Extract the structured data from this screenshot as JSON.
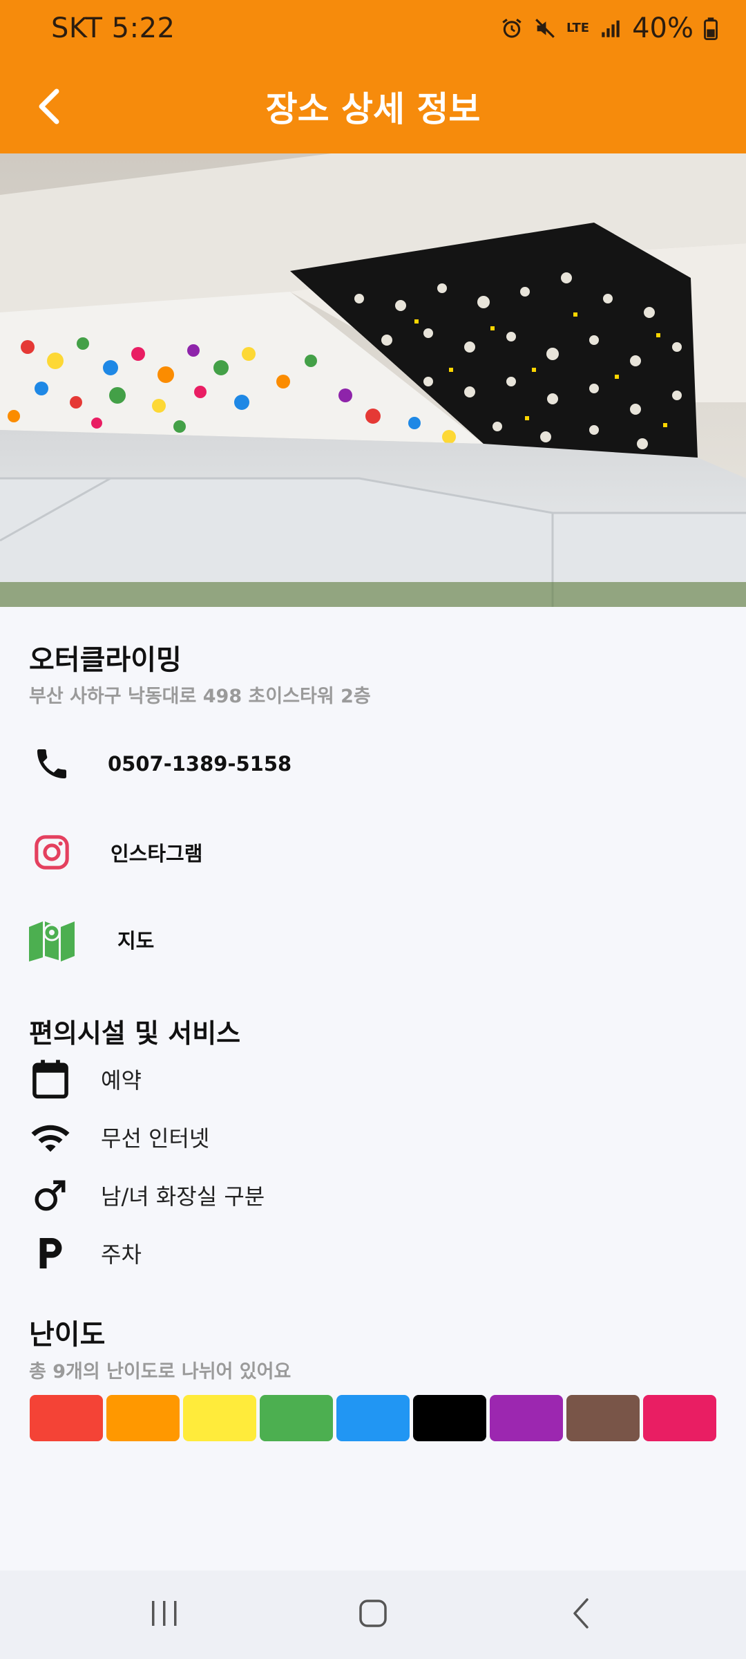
{
  "status_bar": {
    "carrier_time": "SKT 5:22",
    "battery": "40%",
    "net_label": "LTE"
  },
  "app_bar": {
    "title": "장소 상세 정보",
    "back_icon": "chevron-left-icon"
  },
  "place": {
    "name": "오터클라이밍",
    "address": "부산 사하구 낙동대로 498 초이스타워 2층",
    "phone": "0507-1389-5158",
    "instagram_label": "인스타그램",
    "map_label": "지도"
  },
  "amenities": {
    "title": "편의시설 및 서비스",
    "items": [
      {
        "label": "예약",
        "icon": "calendar-icon"
      },
      {
        "label": "무선 인터넷",
        "icon": "wifi-icon"
      },
      {
        "label": "남/녀 화장실 구분",
        "icon": "male-icon"
      },
      {
        "label": "주차",
        "icon": "parking-icon"
      }
    ]
  },
  "difficulty": {
    "title": "난이도",
    "subtitle": "총 9개의 난이도로 나뉘어 있어요",
    "colors": [
      "#f44336",
      "#ff9800",
      "#ffeb3b",
      "#4caf50",
      "#2196f3",
      "#000000",
      "#9c27b0",
      "#795548",
      "#e91e63"
    ]
  },
  "colors": {
    "accent": "#f68b0c",
    "instagram": "#e4405f",
    "map": "#4caf50"
  }
}
